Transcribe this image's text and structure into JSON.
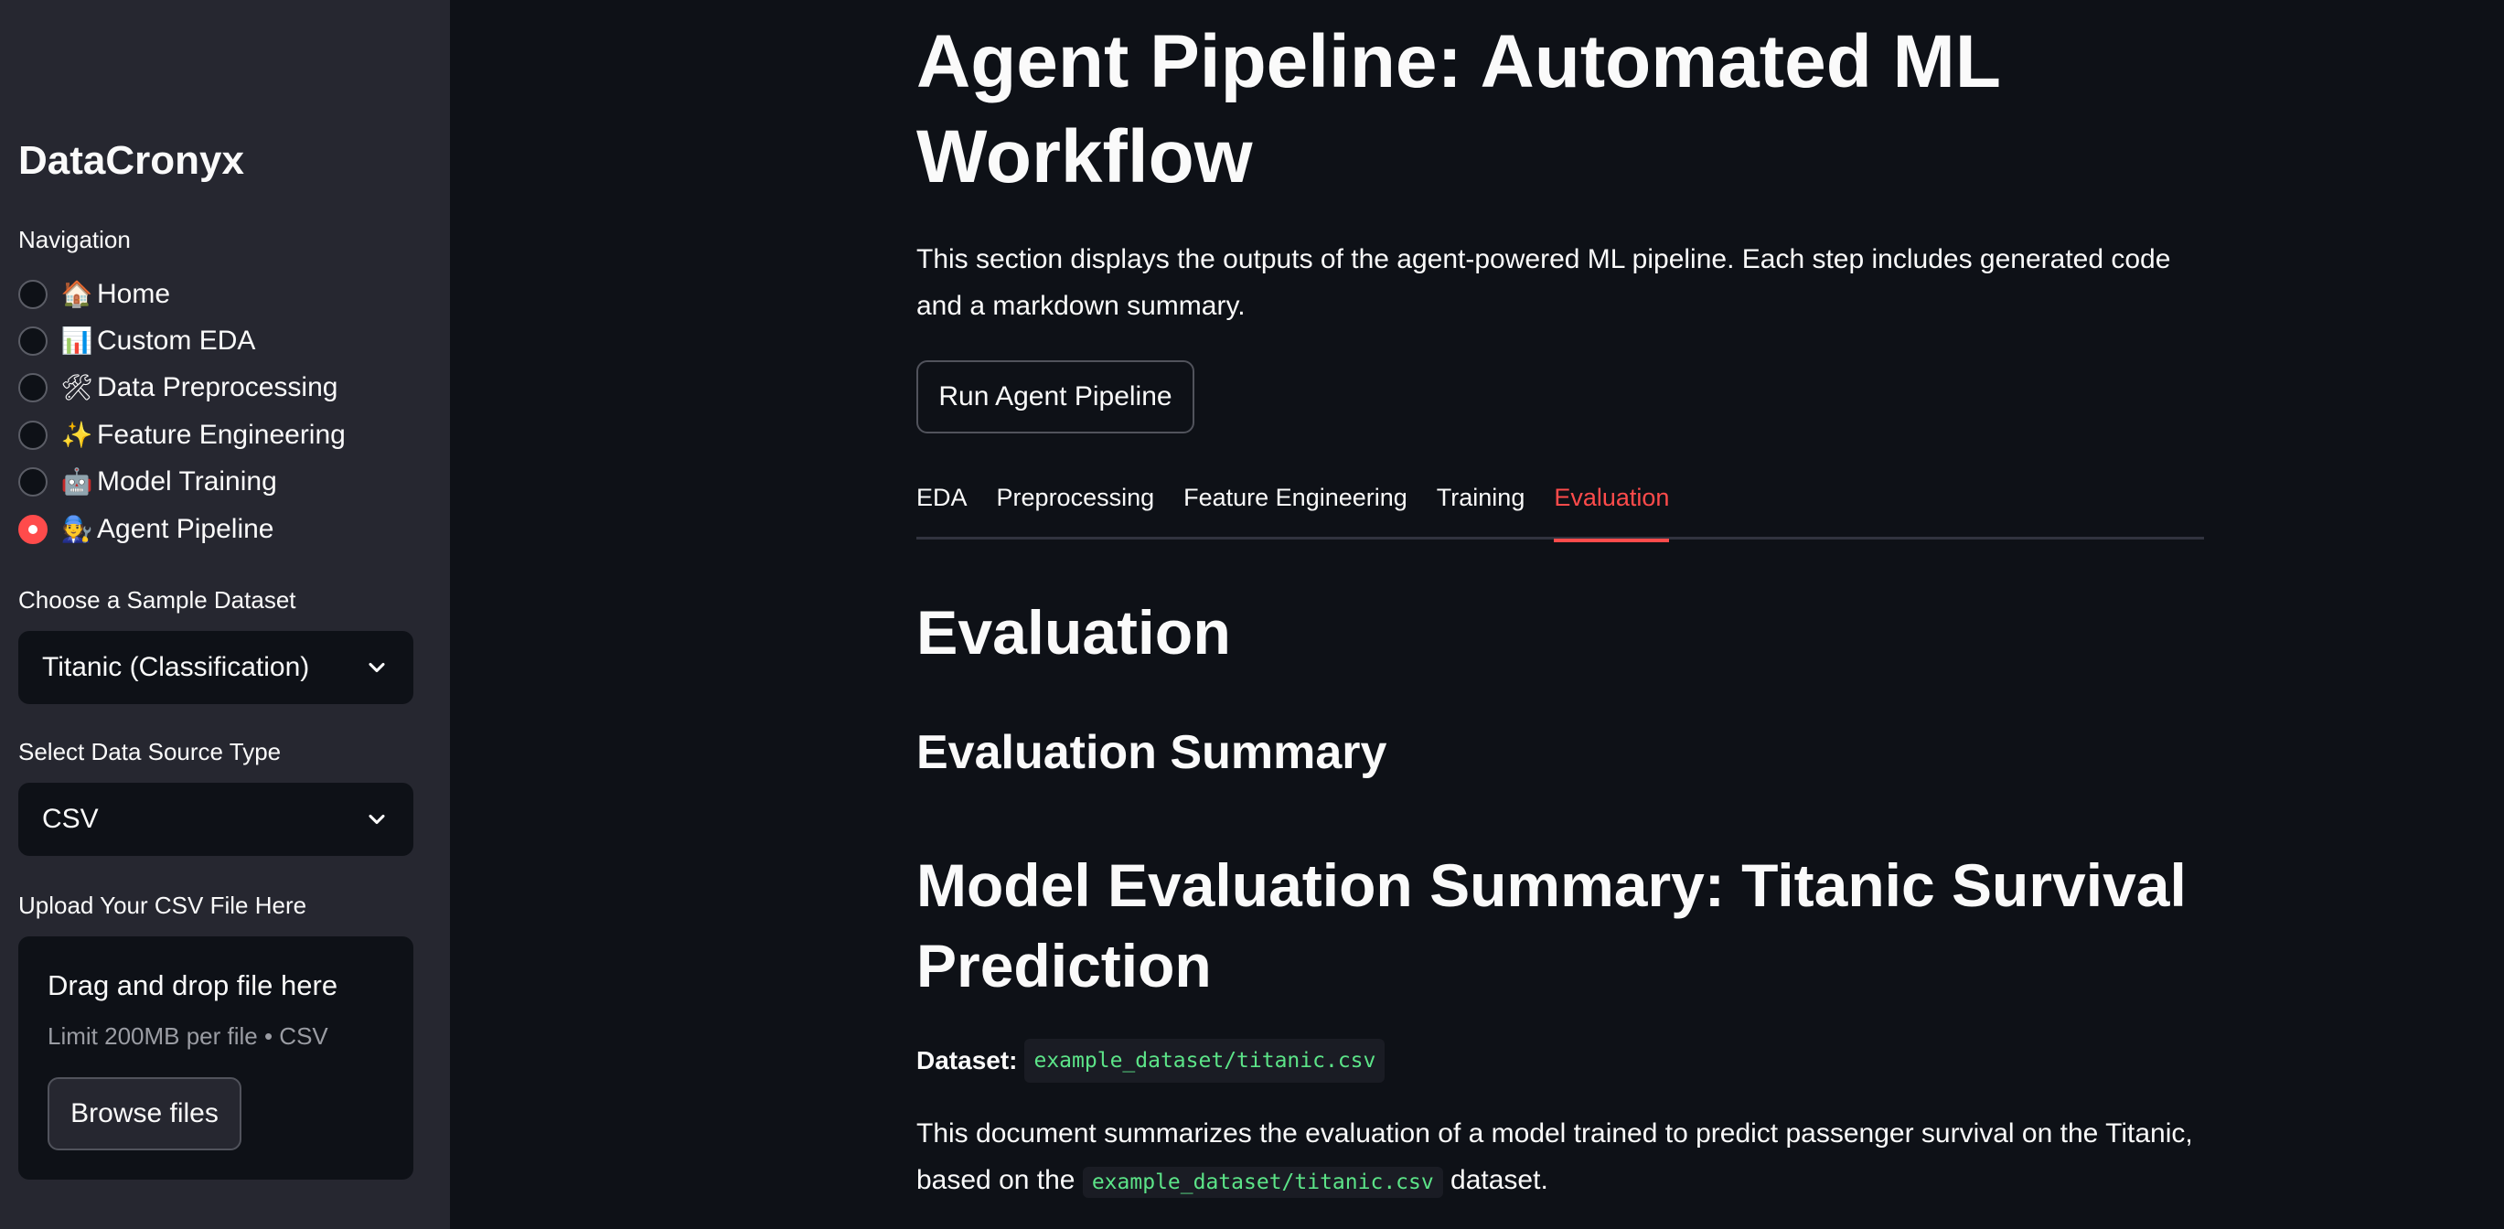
{
  "sidebar": {
    "brand": "DataCronyx",
    "navigation_label": "Navigation",
    "nav_items": [
      {
        "emoji": "🏠",
        "label": "Home",
        "selected": false
      },
      {
        "emoji": "📊",
        "label": "Custom EDA",
        "selected": false
      },
      {
        "emoji": "🛠",
        "label": "Data Preprocessing",
        "selected": false
      },
      {
        "emoji": "✨",
        "label": "Feature Engineering",
        "selected": false
      },
      {
        "emoji": "🤖",
        "label": "Model Training",
        "selected": false
      },
      {
        "emoji": "🧑‍🔧",
        "label": "Agent Pipeline",
        "selected": true
      }
    ],
    "dataset_label": "Choose a Sample Dataset",
    "dataset_value": "Titanic (Classification)",
    "source_label": "Select Data Source Type",
    "source_value": "CSV",
    "upload_label": "Upload Your CSV File Here",
    "upload": {
      "drag_text": "Drag and drop file here",
      "limit_text": "Limit 200MB per file • CSV",
      "browse_label": "Browse files"
    }
  },
  "main": {
    "title": "Agent Pipeline: Automated ML Workflow",
    "intro": "This section displays the outputs of the agent-powered ML pipeline. Each step includes generated code and a markdown summary.",
    "run_button": "Run Agent Pipeline",
    "tabs": [
      {
        "label": "EDA",
        "active": false
      },
      {
        "label": "Preprocessing",
        "active": false
      },
      {
        "label": "Feature Engineering",
        "active": false
      },
      {
        "label": "Training",
        "active": false
      },
      {
        "label": "Evaluation",
        "active": true
      }
    ],
    "evaluation_heading": "Evaluation",
    "evaluation_summary_heading": "Evaluation Summary",
    "model_heading": "Model Evaluation Summary: Titanic Survival Prediction",
    "dataset_label": "Dataset:",
    "dataset_path": "example_dataset/titanic.csv",
    "doc_text_before": "This document summarizes the evaluation of a model trained to predict passenger survival on the Titanic, based on the",
    "doc_code": "example_dataset/titanic.csv",
    "doc_text_after": "dataset."
  },
  "colors": {
    "accent": "#ff4b4b",
    "sidebar_bg": "#262730",
    "main_bg": "#0e1117",
    "code_text": "#5ce488"
  }
}
